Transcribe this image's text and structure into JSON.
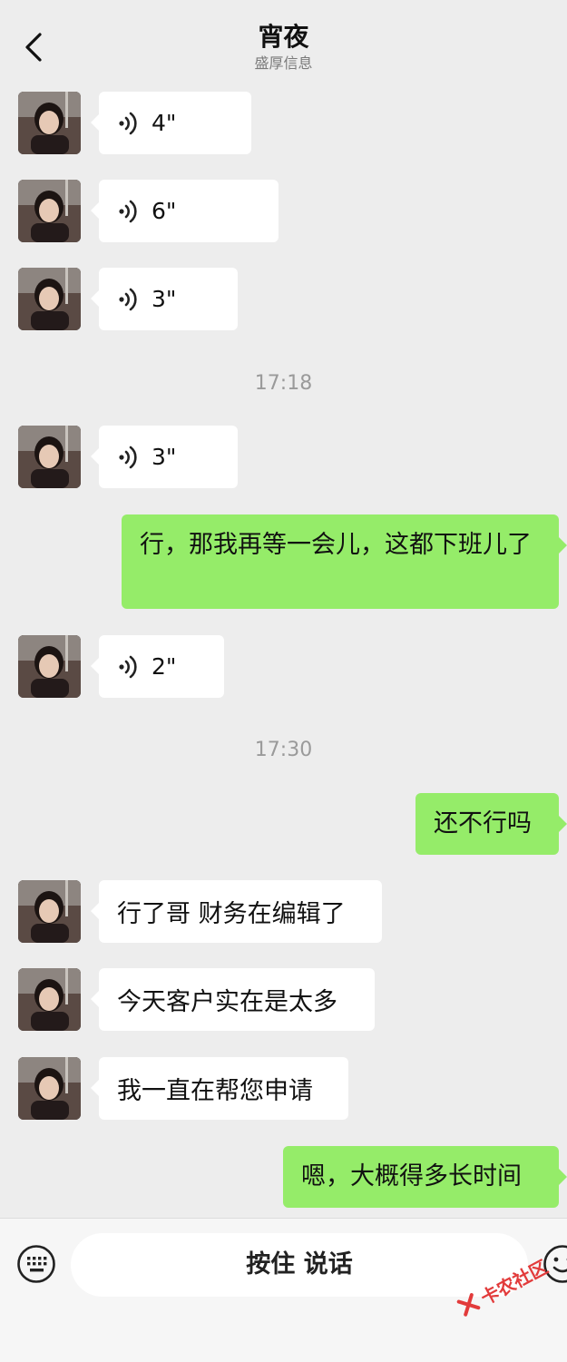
{
  "header": {
    "title": "宵夜",
    "subtitle": "盛厚信息"
  },
  "messages": [
    {
      "type": "voice-in",
      "duration": "4\""
    },
    {
      "type": "voice-in",
      "duration": "6\""
    },
    {
      "type": "voice-in",
      "duration": "3\""
    },
    {
      "type": "time",
      "text": "17:18"
    },
    {
      "type": "voice-in",
      "duration": "3\""
    },
    {
      "type": "text-out",
      "text": "行，那我再等一会儿，这都下班儿了"
    },
    {
      "type": "voice-in",
      "duration": "2\""
    },
    {
      "type": "time",
      "text": "17:30"
    },
    {
      "type": "text-out",
      "text": "还不行吗"
    },
    {
      "type": "text-in",
      "text": "行了哥 财务在编辑了"
    },
    {
      "type": "text-in",
      "text": "今天客户实在是太多"
    },
    {
      "type": "text-in",
      "text": "我一直在帮您申请"
    },
    {
      "type": "text-out",
      "text": "嗯，大概得多长时间"
    }
  ],
  "input_bar": {
    "hold_to_talk_label": "按住 说话"
  },
  "watermark": {
    "text": "卡农社区"
  },
  "colors": {
    "background": "#ededed",
    "incoming_bubble": "#ffffff",
    "outgoing_bubble": "#95ec69"
  },
  "icons": [
    "back-arrow-icon",
    "voice-wave-icon",
    "keyboard-icon",
    "emoji-icon"
  ]
}
